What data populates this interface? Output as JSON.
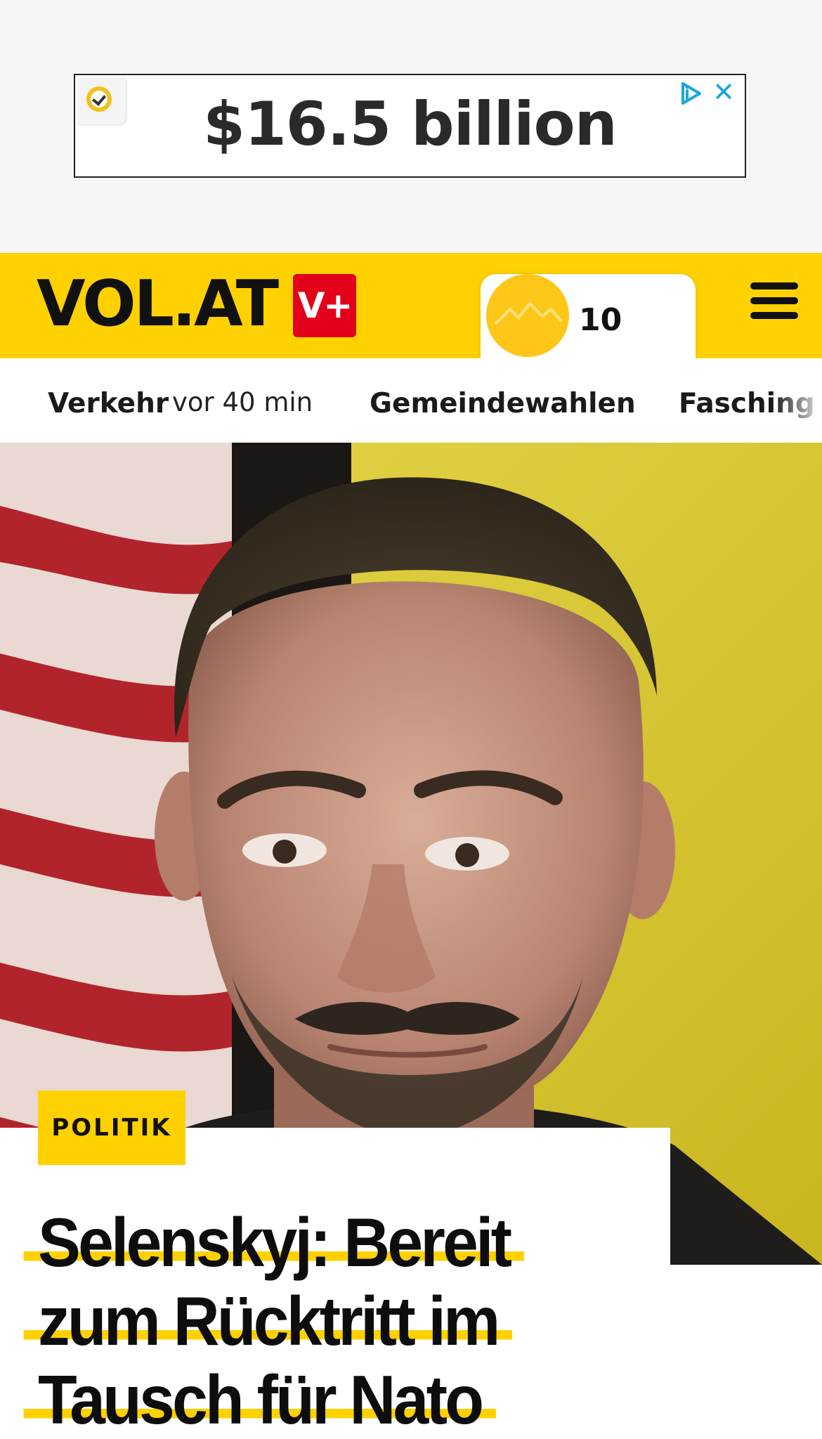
{
  "ad": {
    "headline": "$16.5 billion",
    "badge_icon": "check-badge-icon",
    "choices_icon": "ad-choices-icon",
    "close_icon": "close-icon",
    "close_glyph": "✕"
  },
  "header": {
    "logo": "VOL.AT",
    "vplus_label": "V+",
    "weather_temp": "10",
    "weather_icon": "mountain-sun-icon",
    "menu_icon": "hamburger-menu-icon",
    "brand_color": "#ffd100",
    "accent_color": "#e3001b"
  },
  "topics": {
    "items": [
      {
        "label": "Verkehr",
        "time": "vor 40 min"
      },
      {
        "label": "Gemeindewahlen"
      },
      {
        "label": "Fasching"
      }
    ]
  },
  "article": {
    "category": "POLITIK",
    "headline": "Selenskyj: Bereit zum Rücktritt im Tausch für Nato"
  }
}
